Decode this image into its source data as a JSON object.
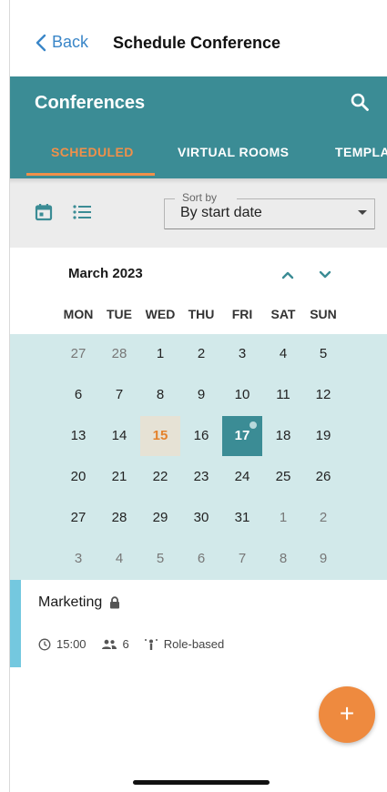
{
  "nav": {
    "back_label": "Back",
    "title": "Schedule Conference"
  },
  "appbar": {
    "title": "Conferences",
    "search_icon": "search-icon"
  },
  "tabs": [
    {
      "label": "SCHEDULED",
      "active": true
    },
    {
      "label": "VIRTUAL ROOMS",
      "active": false
    },
    {
      "label": "TEMPLA",
      "active": false
    }
  ],
  "filter": {
    "view_icons": [
      "calendar-icon",
      "list-icon"
    ],
    "sort_label": "Sort by",
    "sort_value": "By start date"
  },
  "calendar": {
    "month": "March 2023",
    "weekdays": [
      "MON",
      "TUE",
      "WED",
      "THU",
      "FRI",
      "SAT",
      "SUN"
    ],
    "weeks": [
      [
        "27",
        "28",
        "1",
        "2",
        "3",
        "4",
        "5"
      ],
      [
        "6",
        "7",
        "8",
        "9",
        "10",
        "11",
        "12"
      ],
      [
        "13",
        "14",
        "15",
        "16",
        "17",
        "18",
        "19"
      ],
      [
        "20",
        "21",
        "22",
        "23",
        "24",
        "25",
        "26"
      ],
      [
        "27",
        "28",
        "29",
        "30",
        "31",
        "1",
        "2"
      ],
      [
        "3",
        "4",
        "5",
        "6",
        "7",
        "8",
        "9"
      ]
    ],
    "today": "15",
    "selected": "17",
    "colors": {
      "selected": "#3b8c95",
      "today": "#e4822c",
      "range": "#d2e9ea"
    }
  },
  "conference": {
    "title": "Marketing",
    "time": "15:00",
    "participants": "6",
    "mode": "Role-based"
  },
  "fab": {
    "label": "+"
  },
  "colors": {
    "header": "#3b8c95",
    "accent": "#f0904a",
    "fab": "#ee8a3f",
    "link": "#3a86c8"
  }
}
